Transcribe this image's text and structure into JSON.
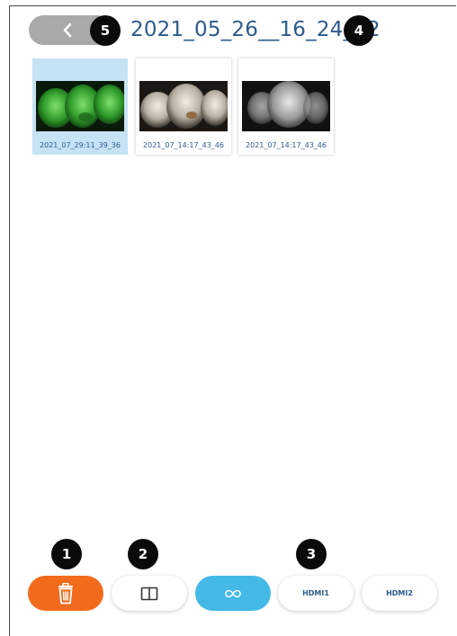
{
  "header": {
    "folder_title": "2021_05_26__16_24_12",
    "back_icon": "chevron-left-icon"
  },
  "gallery": {
    "items": [
      {
        "caption": "2021_07_29:11_39_36",
        "style": "fluorescence-green",
        "selected": true
      },
      {
        "caption": "2021_07_14:17_43_46",
        "style": "white-light",
        "selected": false
      },
      {
        "caption": "2021_07_14:17_43_46",
        "style": "grayscale",
        "selected": false
      }
    ]
  },
  "toolbar": {
    "delete_icon": "trash-icon",
    "compare_icon": "split-view-icon",
    "link_icon": "infinity-link-icon",
    "hdmi1_label": "HDMI1",
    "hdmi2_label": "HDMI2",
    "colors": {
      "delete": "#f26a1b",
      "link": "#44b9e6"
    }
  },
  "callouts": [
    "1",
    "2",
    "3",
    "4",
    "5"
  ]
}
